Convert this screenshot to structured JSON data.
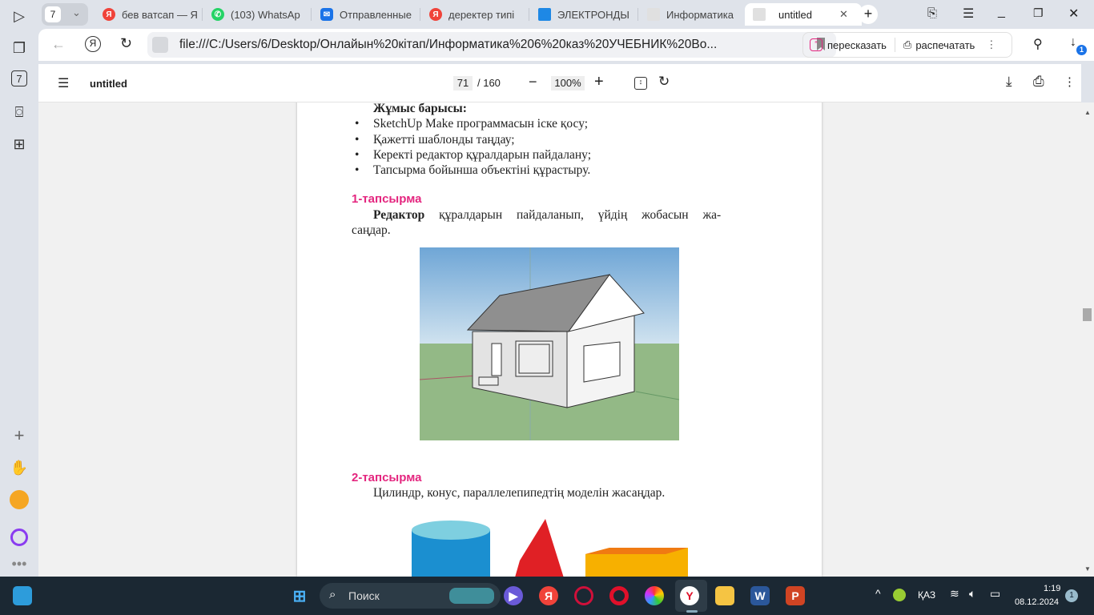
{
  "browser": {
    "tab_count": "7",
    "tabs": [
      {
        "title": "бев ватсап — Я",
        "icon": "yandex-icon",
        "color": "#f0433a"
      },
      {
        "title": "(103) WhatsAp",
        "icon": "whatsapp-icon",
        "color": "#25d366"
      },
      {
        "title": "Отправленные",
        "icon": "mail-icon",
        "color": "#1a73e8"
      },
      {
        "title": "деректер типі",
        "icon": "yandex-icon",
        "color": "#f0433a"
      },
      {
        "title": "ЭЛЕКТРОНДЫ",
        "icon": "grid-icon",
        "color": "#1e88e5"
      },
      {
        "title": "Информатика",
        "icon": "pdf-file-icon",
        "color": "#bbb"
      },
      {
        "title": "untitled",
        "icon": "pdf-file-icon",
        "color": "#bbb",
        "active": true
      }
    ],
    "url": "file:///C:/Users/6/Desktop/Онлайын%20кітап/Информатика%206%20каз%20УЧЕБНИК%20Bo...",
    "retell_label": "пересказать",
    "print_label": "распечатать",
    "downloads_badge": "1"
  },
  "pdf": {
    "title": "untitled",
    "current_page": "71",
    "total_pages": "/ 160",
    "zoom": "100%"
  },
  "content": {
    "heading": "Жұмыс барысы:",
    "bullets": [
      "SketchUp Make программасын іске қосу;",
      "Қажетті шаблонды таңдау;",
      "Керекті редактор құралдарын пайдалану;",
      "Тапсырма бойынша объектіні құрастыру."
    ],
    "task1_title": "1-тапсырма",
    "task1_bold": "Редактор",
    "task1_text": " құралдарын пайдаланып, үйдің жобасын жа-",
    "task1_text2": "саңдар.",
    "task2_title": "2-тапсырма",
    "task2_text": "Цилиндр, конус, параллелепипедтің моделін жасаңдар."
  },
  "taskbar": {
    "search_placeholder": "Поиск",
    "language": "ҚАЗ",
    "time": "1:19",
    "date": "08.12.2024",
    "notifications": "1"
  },
  "colors": {
    "accent_pink": "#e4267f",
    "taskbar": "#1b2833"
  }
}
